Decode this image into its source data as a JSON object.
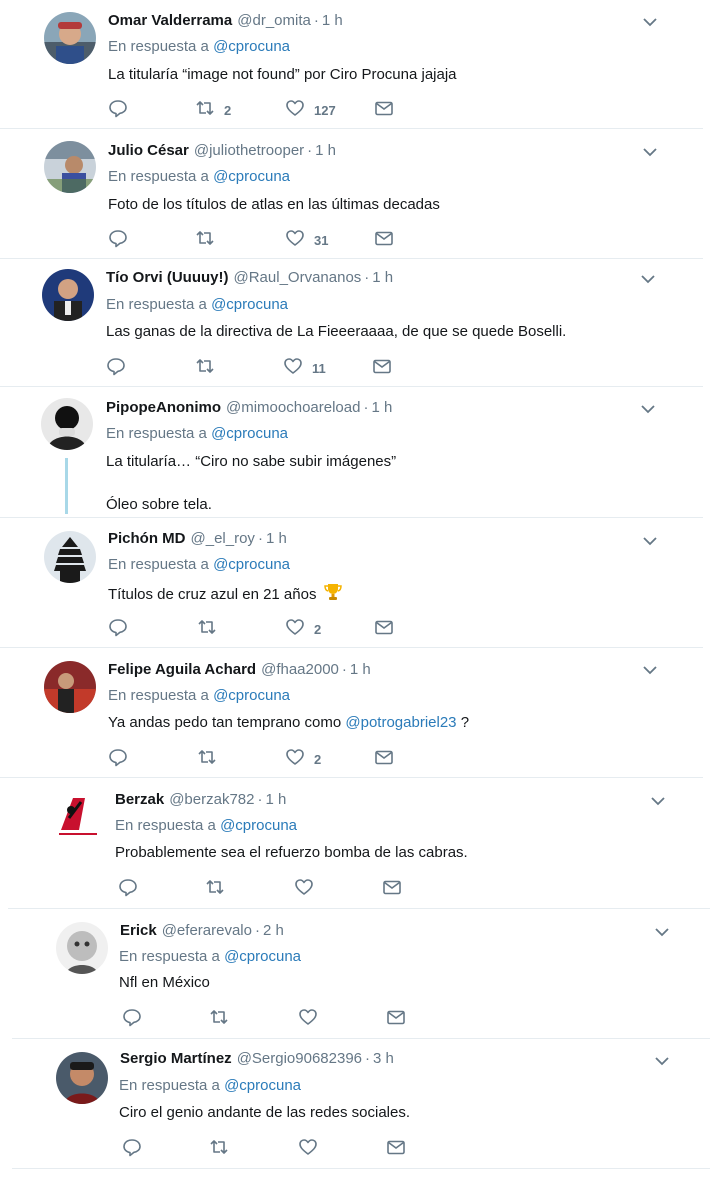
{
  "reply_prefix": "En respuesta a",
  "colors": {
    "link": "#2b7bb9",
    "meta": "#657786",
    "divider": "#e6ecf0",
    "thread_line": "#a8d8e8"
  },
  "tweets": [
    {
      "name": "Omar Valderrama",
      "handle": "@dr_omita",
      "time": "1 h",
      "reply_to": "@cprocuna",
      "text": "La titularía “image not found” por Ciro Procuna jajaja",
      "retweets": "2",
      "likes": "127"
    },
    {
      "name": "Julio César",
      "handle": "@juliothetrooper",
      "time": "1 h",
      "reply_to": "@cprocuna",
      "text": "Foto de los títulos de atlas en las últimas decadas",
      "retweets": "",
      "likes": "31"
    },
    {
      "name": "Tío Orvi (Uuuuy!)",
      "handle": "@Raul_Orvananos",
      "time": "1 h",
      "reply_to": "@cprocuna",
      "text": "Las ganas de la directiva de La Fieeeraaaa, de que se quede Boselli.",
      "retweets": "",
      "likes": "11"
    },
    {
      "name": "PipopeAnonimo",
      "handle": "@mimoochoareload",
      "time": "1 h",
      "reply_to": "@cprocuna",
      "text": "La titularía… “Ciro no sabe subir imágenes”",
      "text2": "Óleo sobre tela."
    },
    {
      "name": "Pichón MD",
      "handle": "@_el_roy",
      "time": "1 h",
      "reply_to": "@cprocuna",
      "text": "Títulos de cruz azul en 21 años",
      "emoji": "trophy-emoji",
      "retweets": "",
      "likes": "2"
    },
    {
      "name": "Felipe Aguila Achard",
      "handle": "@fhaa2000",
      "time": "1 h",
      "reply_to": "@cprocuna",
      "text_before": "Ya andas pedo tan temprano como ",
      "text_mention": "@potrogabriel23",
      "text_after": " ?",
      "retweets": "",
      "likes": "2"
    },
    {
      "name": "Berzak",
      "handle": "@berzak782",
      "time": "1 h",
      "reply_to": "@cprocuna",
      "text": "Probablemente sea el refuerzo bomba de las cabras.",
      "retweets": "",
      "likes": ""
    },
    {
      "name": "Erick",
      "handle": "@eferarevalo",
      "time": "2 h",
      "reply_to": "@cprocuna",
      "text": "Nfl en México",
      "retweets": "",
      "likes": ""
    },
    {
      "name": "Sergio Martínez",
      "handle": "@Sergio90682396",
      "time": "3 h",
      "reply_to": "@cprocuna",
      "text": "Ciro el genio andante de las redes sociales.",
      "retweets": "",
      "likes": ""
    }
  ]
}
